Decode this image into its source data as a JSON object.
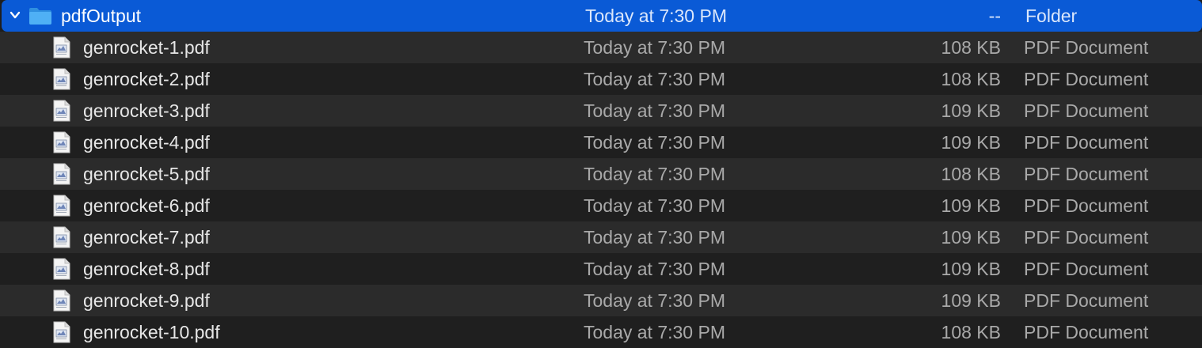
{
  "folder": {
    "name": "pdfOutput",
    "date": "Today at 7:30 PM",
    "size": "--",
    "kind": "Folder",
    "icon": "folder-icon",
    "disclosure_icon": "chevron-down-icon"
  },
  "files": [
    {
      "name": "genrocket-1.pdf",
      "date": "Today at 7:30 PM",
      "size": "108 KB",
      "kind": "PDF Document"
    },
    {
      "name": "genrocket-2.pdf",
      "date": "Today at 7:30 PM",
      "size": "108 KB",
      "kind": "PDF Document"
    },
    {
      "name": "genrocket-3.pdf",
      "date": "Today at 7:30 PM",
      "size": "109 KB",
      "kind": "PDF Document"
    },
    {
      "name": "genrocket-4.pdf",
      "date": "Today at 7:30 PM",
      "size": "109 KB",
      "kind": "PDF Document"
    },
    {
      "name": "genrocket-5.pdf",
      "date": "Today at 7:30 PM",
      "size": "108 KB",
      "kind": "PDF Document"
    },
    {
      "name": "genrocket-6.pdf",
      "date": "Today at 7:30 PM",
      "size": "109 KB",
      "kind": "PDF Document"
    },
    {
      "name": "genrocket-7.pdf",
      "date": "Today at 7:30 PM",
      "size": "109 KB",
      "kind": "PDF Document"
    },
    {
      "name": "genrocket-8.pdf",
      "date": "Today at 7:30 PM",
      "size": "109 KB",
      "kind": "PDF Document"
    },
    {
      "name": "genrocket-9.pdf",
      "date": "Today at 7:30 PM",
      "size": "109 KB",
      "kind": "PDF Document"
    },
    {
      "name": "genrocket-10.pdf",
      "date": "Today at 7:30 PM",
      "size": "108 KB",
      "kind": "PDF Document"
    }
  ],
  "colors": {
    "selection": "#0a5ad6",
    "folder_blue": "#3fa3ef",
    "row_alt": "#2b2b2b",
    "row_base": "#1f1f1f"
  }
}
